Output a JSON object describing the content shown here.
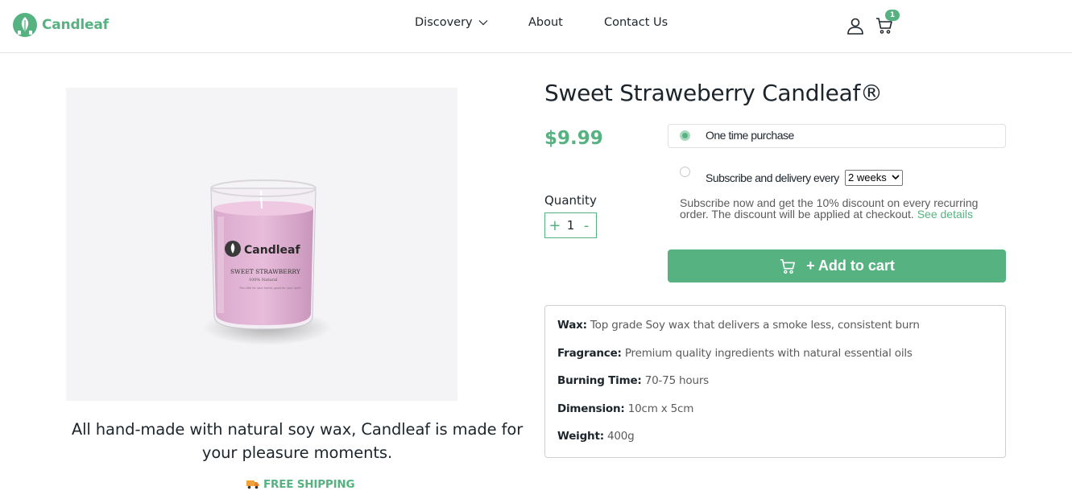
{
  "brand": {
    "name": "Candleaf",
    "accent": "#56b280"
  },
  "nav": {
    "discovery": "Discovery",
    "about": "About",
    "contact": "Contact Us"
  },
  "header": {
    "cart_count": "1"
  },
  "product": {
    "title": "Sweet Straweberry Candleaf®",
    "price": "$9.99",
    "image_label": {
      "brand": "Candleaf",
      "name": "SWEET STRAWBERRY",
      "sub": "100% Natural",
      "desc": "The vibe for your home, good for your spirit."
    },
    "tagline": "All hand-made with natural soy wax, Candleaf is made for your pleasure moments.",
    "shipping": "FREE SHIPPING"
  },
  "quantity": {
    "label": "Quantity",
    "value": "1",
    "plus": "+",
    "minus": "-"
  },
  "purchase": {
    "one_time": "One time purchase",
    "subscribe": "Subscribe and delivery every",
    "frequency": "2 weeks",
    "note": "Subscribe now and get the 10% discount on every recurring order. The discount will be applied at checkout.",
    "see_details": "See details",
    "add_to_cart": "+ Add to cart"
  },
  "specs": [
    {
      "key": "Wax:",
      "value": "Top grade Soy wax that delivers a smoke less, consistent burn"
    },
    {
      "key": "Fragrance:",
      "value": "Premium quality ingredients with natural essential oils"
    },
    {
      "key": "Burning Time:",
      "value": "70-75 hours"
    },
    {
      "key": "Dimension:",
      "value": "10cm x 5cm"
    },
    {
      "key": "Weight:",
      "value": "400g"
    }
  ]
}
